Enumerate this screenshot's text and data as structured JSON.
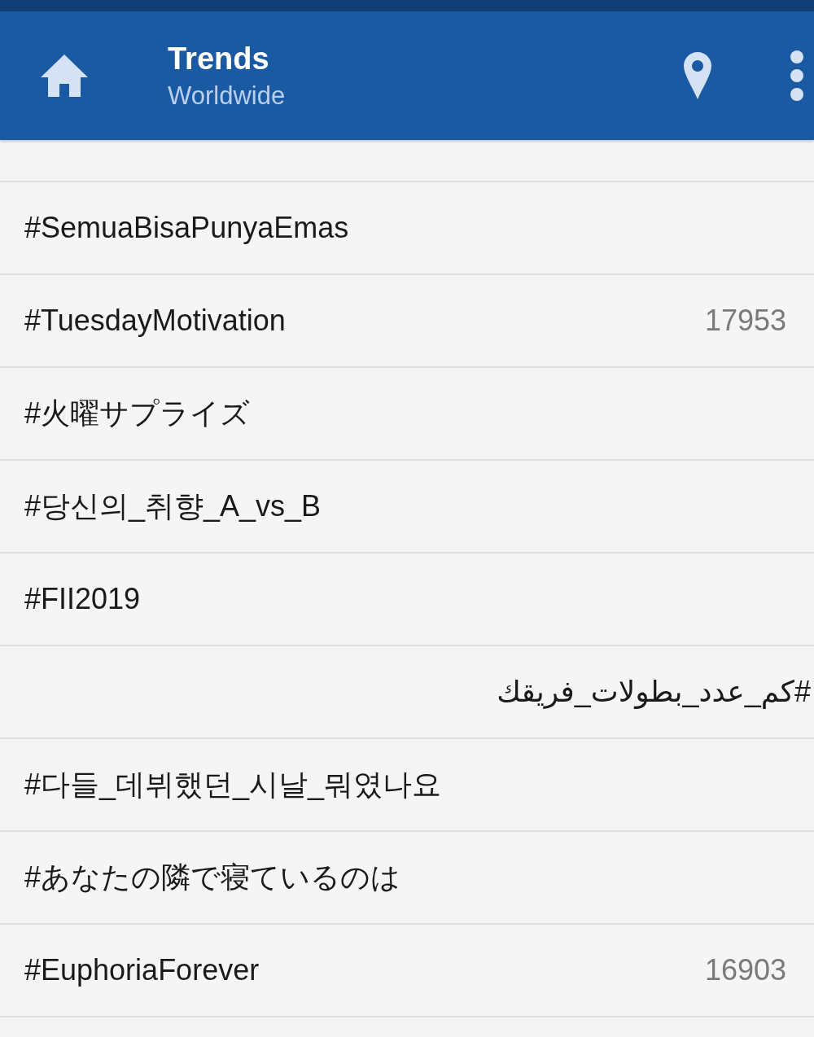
{
  "header": {
    "title": "Trends",
    "subtitle": "Worldwide"
  },
  "trends": [
    {
      "kind": "ltr",
      "name": "#SemuaBisaPunyaEmas"
    },
    {
      "kind": "ltr",
      "name": "#TuesdayMotivation",
      "count": "17953"
    },
    {
      "kind": "ltr",
      "name": "#火曜サプライズ"
    },
    {
      "kind": "ltr",
      "name": "#당신의_취향_A_vs_B"
    },
    {
      "kind": "ltr",
      "name": "#FII2019"
    },
    {
      "kind": "rtl",
      "name": "#كم_عدد_بطولات_فريقك"
    },
    {
      "kind": "ltr",
      "name": "#다들_데뷔했던_시날_뭐였나요"
    },
    {
      "kind": "ltr",
      "name": "#あなたの隣で寝ているのは"
    },
    {
      "kind": "ltr",
      "name": "#EuphoriaForever",
      "count": "16903"
    }
  ]
}
